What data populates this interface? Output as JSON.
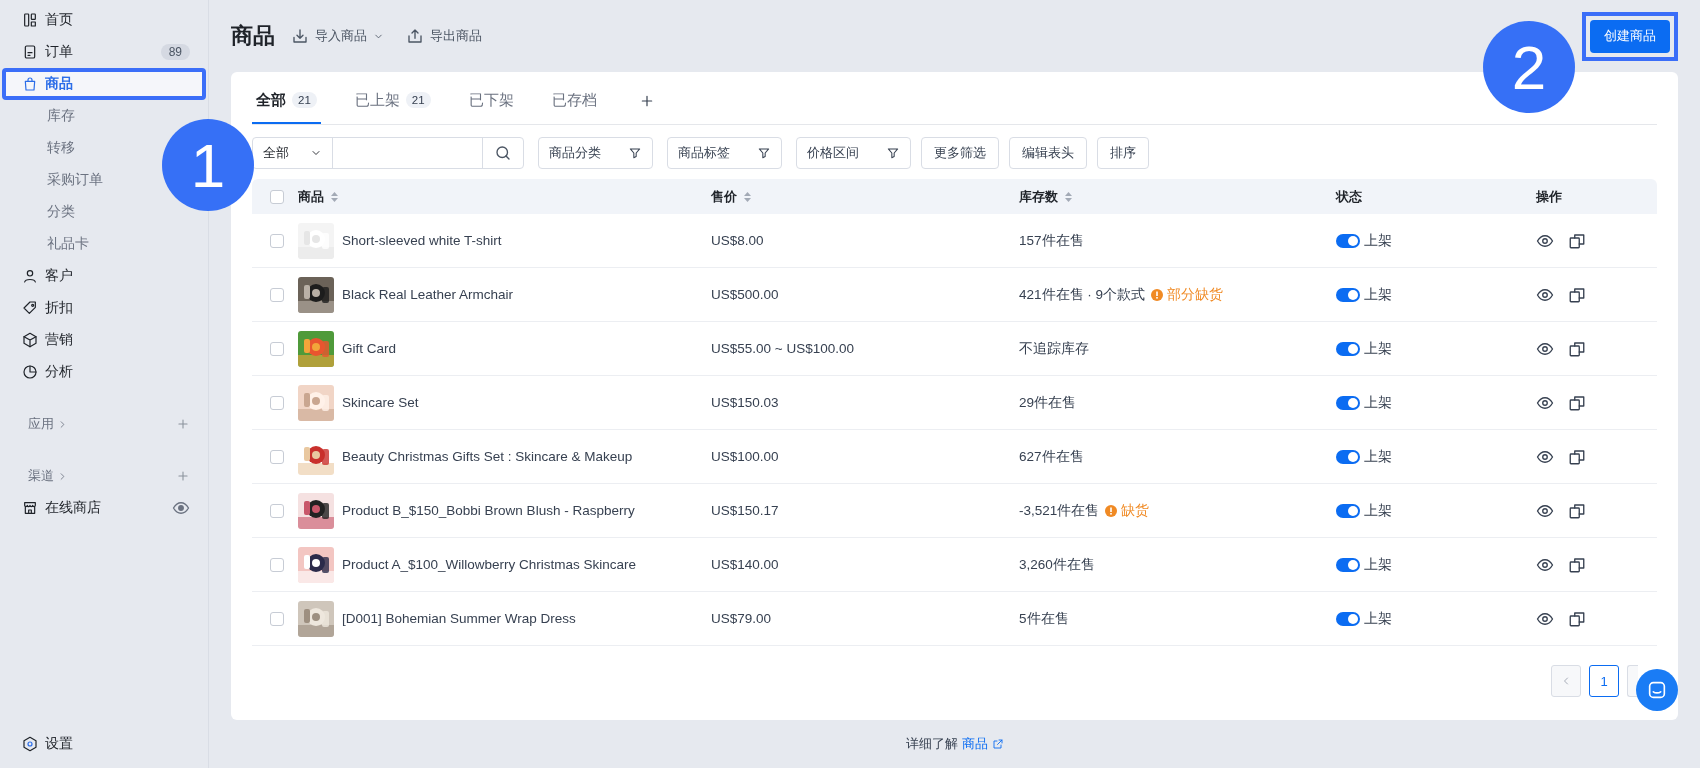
{
  "sidebar": {
    "items": [
      {
        "label": "首页",
        "selected": false,
        "highlighted": false
      },
      {
        "label": "订单",
        "badge": "89",
        "selected": false,
        "highlighted": false
      },
      {
        "label": "商品",
        "selected": true,
        "highlighted": true,
        "children": [
          {
            "label": "库存",
            "selected": false
          },
          {
            "label": "转移",
            "selected": false
          },
          {
            "label": "采购订单",
            "selected": false
          },
          {
            "label": "分类",
            "selected": false
          },
          {
            "label": "礼品卡",
            "selected": false
          }
        ]
      },
      {
        "label": "客户",
        "selected": false,
        "highlighted": false
      },
      {
        "label": "折扣",
        "selected": false,
        "highlighted": false
      },
      {
        "label": "营销",
        "selected": false,
        "highlighted": false
      },
      {
        "label": "分析",
        "selected": false,
        "highlighted": false
      }
    ],
    "sections": [
      {
        "label": "应用"
      },
      {
        "label": "渠道",
        "children": [
          {
            "label": "在线商店"
          }
        ]
      }
    ],
    "settings": "设置"
  },
  "header": {
    "title": "商品",
    "actions": [
      {
        "label": "导入商品",
        "dropdown": true
      },
      {
        "label": "导出商品",
        "dropdown": false
      }
    ],
    "primary_button": {
      "label": "创建商品",
      "highlighted": true
    }
  },
  "tabs": [
    {
      "label": "全部",
      "count": "21",
      "selected": true
    },
    {
      "label": "已上架",
      "count": "21",
      "selected": false
    },
    {
      "label": "已下架",
      "selected": false
    },
    {
      "label": "已存档",
      "selected": false
    }
  ],
  "filters": {
    "scope": "全部",
    "selects": [
      "商品分类",
      "商品标签",
      "价格区间"
    ],
    "buttons": [
      "更多筛选",
      "编辑表头",
      "排序"
    ]
  },
  "table": {
    "select_all_checked": false,
    "columns": [
      {
        "label": "商品",
        "sortable": true
      },
      {
        "label": "售价",
        "sortable": true
      },
      {
        "label": "库存数",
        "sortable": true
      },
      {
        "label": "状态",
        "sortable": false
      },
      {
        "label": "操作",
        "sortable": false
      }
    ],
    "rows": [
      {
        "checked": false,
        "name": "Short-sleeved white T-shirt",
        "price": "US$8.00",
        "stock": "157件在售",
        "listed": true,
        "status": "上架"
      },
      {
        "checked": false,
        "name": "Black Real Leather Armchair",
        "price": "US$500.00",
        "stock": "421件在售 · 9个款式",
        "warning": "部分缺货",
        "listed": true,
        "status": "上架"
      },
      {
        "checked": false,
        "name": "Gift Card",
        "price": "US$55.00 ~ US$100.00",
        "stock": "不追踪库存",
        "listed": true,
        "status": "上架"
      },
      {
        "checked": false,
        "name": "Skincare Set",
        "price": "US$150.03",
        "stock": "29件在售",
        "listed": true,
        "status": "上架"
      },
      {
        "checked": false,
        "name": "Beauty Christmas Gifts Set : Skincare & Makeup",
        "price": "US$100.00",
        "stock": "627件在售",
        "listed": true,
        "status": "上架"
      },
      {
        "checked": false,
        "name": "Product B_$150_Bobbi Brown Blush - Raspberry",
        "price": "US$150.17",
        "stock": "-3,521件在售",
        "warning": "缺货",
        "listed": true,
        "status": "上架"
      },
      {
        "checked": false,
        "name": "Product A_$100_Willowberry Christmas Skincare",
        "price": "US$140.00",
        "stock": "3,260件在售",
        "listed": true,
        "status": "上架"
      },
      {
        "checked": false,
        "name": "[D001] Bohemian Summer Wrap Dress",
        "price": "US$79.00",
        "stock": "5件在售",
        "listed": true,
        "status": "上架"
      }
    ]
  },
  "pagination": {
    "pages": [
      {
        "label": "1",
        "selected": true
      }
    ]
  },
  "footer": {
    "text": "详细了解",
    "link": "商品"
  },
  "annotations": [
    {
      "label": "1"
    },
    {
      "label": "2"
    }
  ]
}
